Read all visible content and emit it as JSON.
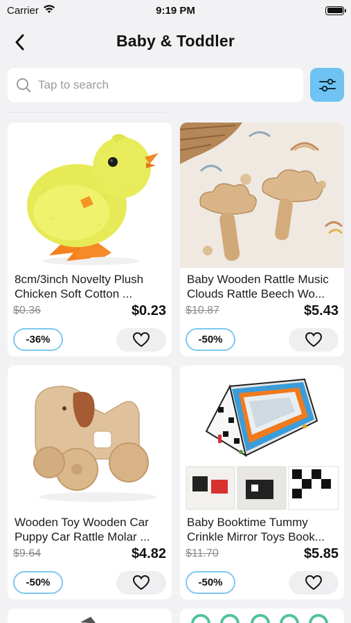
{
  "status_bar": {
    "carrier": "Carrier",
    "time": "9:19 PM"
  },
  "nav": {
    "title": "Baby & Toddler"
  },
  "search": {
    "placeholder": "Tap to search"
  },
  "products": [
    {
      "title": "8cm/3inch Novelty Plush Chicken Soft Cotton ...",
      "old_price": "$0.36",
      "price": "$0.23",
      "discount": "-36%"
    },
    {
      "title": "Baby Wooden Rattle Music Clouds Rattle Beech Wo...",
      "old_price": "$10.87",
      "price": "$5.43",
      "discount": "-50%"
    },
    {
      "title": "Wooden Toy Wooden Car Puppy Car Rattle Molar ...",
      "old_price": "$9.64",
      "price": "$4.82",
      "discount": "-50%"
    },
    {
      "title": "Baby Booktime Tummy Crinkle Mirror Toys Book...",
      "old_price": "$11.70",
      "price": "$5.85",
      "discount": "-50%"
    }
  ],
  "colors": {
    "accent": "#6ec3f2",
    "badge_border": "#7ec7ee",
    "background": "#f2f2f4"
  },
  "icons": [
    "wifi-icon",
    "battery-icon",
    "back-chevron-icon",
    "search-icon",
    "filter-sliders-icon",
    "heart-icon"
  ]
}
